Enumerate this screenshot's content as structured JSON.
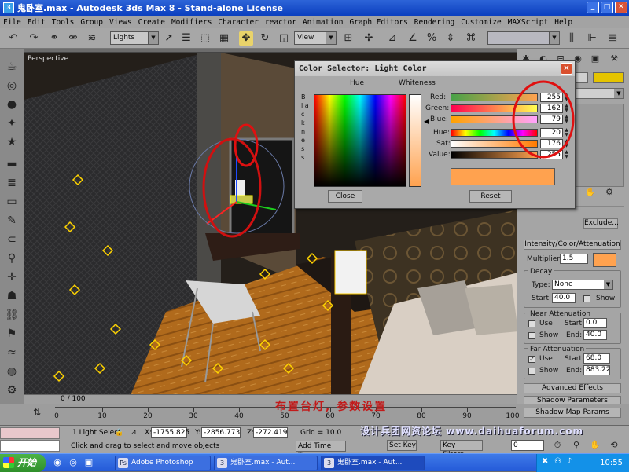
{
  "window": {
    "title": "鬼卧室.max - Autodesk 3ds Max 8  - Stand-alone License"
  },
  "menu": [
    "File",
    "Edit",
    "Tools",
    "Group",
    "Views",
    "Create",
    "Modifiers",
    "Character",
    "reactor",
    "Animation",
    "Graph Editors",
    "Rendering",
    "Customize",
    "MAXScript",
    "Help"
  ],
  "toolbar": {
    "selection_set": "Lights",
    "ref_coord": "View"
  },
  "viewport": {
    "label": "Perspective"
  },
  "dialog": {
    "title": "Color Selector: Light Color",
    "hue_label": "Hue",
    "whiteness_label": "Whiteness",
    "blackness_label": "B l a c k n e s s",
    "channels": [
      {
        "label": "Red:",
        "value": "255"
      },
      {
        "label": "Green:",
        "value": "162"
      },
      {
        "label": "Blue:",
        "value": "79"
      },
      {
        "label": "Hue:",
        "value": "20"
      },
      {
        "label": "Sat:",
        "value": "176"
      },
      {
        "label": "Value:",
        "value": "255"
      }
    ],
    "close_label": "Close",
    "reset_label": "Reset",
    "swatch_color": "#ffa24f"
  },
  "panel": {
    "exclude_label": "Exclude...",
    "intensity_rollout": "Intensity/Color/Attenuation",
    "multiplier_label": "Multiplier:",
    "multiplier_value": "1.5",
    "decay_label": "Decay",
    "type_label": "Type:",
    "type_value": "None",
    "start_label": "Start:",
    "decay_start": "40.0",
    "show_label": "Show",
    "near_label": "Near Attenuation",
    "use_label": "Use",
    "near_start": "0.0",
    "end_label": "End:",
    "near_end": "40.0",
    "far_label": "Far Attenuation",
    "far_start": "68.0",
    "far_end": "883.22",
    "advanced_effects": "Advanced Effects",
    "shadow_params": "Shadow Parameters",
    "shadow_map_params": "Shadow Map Params"
  },
  "timeline": {
    "slider_label": "0 / 100",
    "ticks": [
      "0",
      "10",
      "20",
      "30",
      "40",
      "50",
      "60",
      "70",
      "80",
      "90",
      "100"
    ]
  },
  "status": {
    "selection": "1 Light Select",
    "x_label": "X:",
    "x_value": "-1755.825",
    "y_label": "Y:",
    "y_value": "-2856.773",
    "z_label": "Z:",
    "z_value": "-272.419",
    "grid": "Grid = 10.0",
    "prompt": "Click and drag to select and move objects",
    "add_time_tag": "Add Time Tag",
    "set_key": "Set Key",
    "key_filters": "Key Filters...",
    "frame": "0"
  },
  "annotation": "布置台灯, 参数设置",
  "watermark": "设计兵团网资论坛  www.daihuaforum.com",
  "taskbar": {
    "start": "开始",
    "tasks": [
      "Adobe Photoshop",
      "鬼卧室.max - Aut...",
      "鬼卧室.max - Aut..."
    ],
    "clock": "10:55"
  }
}
